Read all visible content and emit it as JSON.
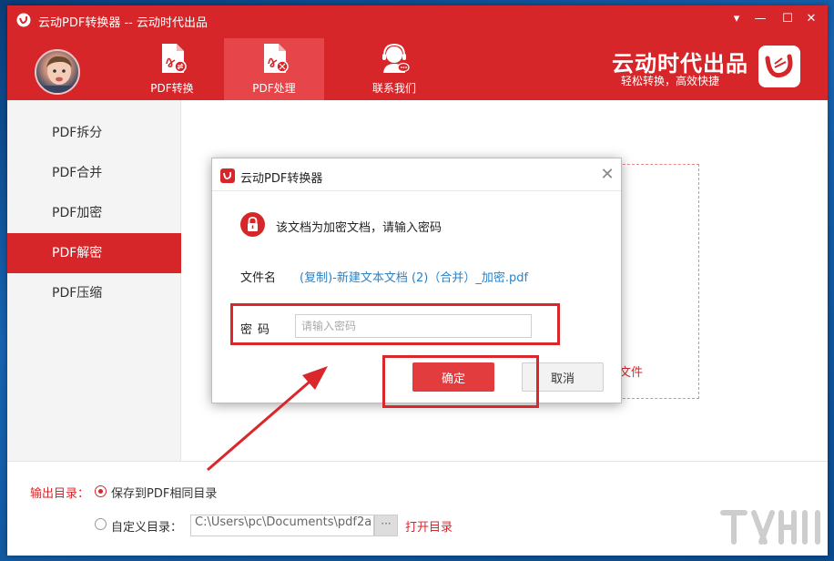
{
  "window": {
    "title": "云动PDF转换器 -- 云动时代出品",
    "controls": [
      "▾",
      "—",
      "☐",
      "✕"
    ]
  },
  "header": {
    "tabs": [
      {
        "label": "PDF转换",
        "icon": "pdf-convert-icon",
        "active": false
      },
      {
        "label": "PDF处理",
        "icon": "pdf-process-icon",
        "active": true
      },
      {
        "label": "联系我们",
        "icon": "support-headset-icon",
        "active": false
      }
    ],
    "brand": "云动时代出品",
    "brand_sub": "轻松转换，高效快捷"
  },
  "sidebar": {
    "items": [
      {
        "label": "PDF拆分",
        "active": false
      },
      {
        "label": "PDF合并",
        "active": false
      },
      {
        "label": "PDF加密",
        "active": false
      },
      {
        "label": "PDF解密",
        "active": true
      },
      {
        "label": "PDF压缩",
        "active": false
      }
    ]
  },
  "main": {
    "drop_hint": "文件"
  },
  "output": {
    "label": "输出目录：",
    "option_same": "保存到PDF相同目录",
    "option_custom": "自定义目录：",
    "path_value": "C:\\Users\\pc\\Documents\\pdf2a",
    "browse_label": "···",
    "open_dir": "打开目录"
  },
  "dialog": {
    "title": "云动PDF转换器",
    "close": "✕",
    "message": "该文档为加密文档，请输入密码",
    "filename_label": "文件名",
    "filename_value": "(复制)-新建文本文档 (2)（合并）_加密.pdf",
    "password_label": "密码",
    "password_placeholder": "请输入密码",
    "ok_label": "确定",
    "cancel_label": "取消"
  },
  "colors": {
    "brand_red": "#d6262a",
    "tab_active": "#e64549",
    "link_blue": "#2a83c8"
  }
}
